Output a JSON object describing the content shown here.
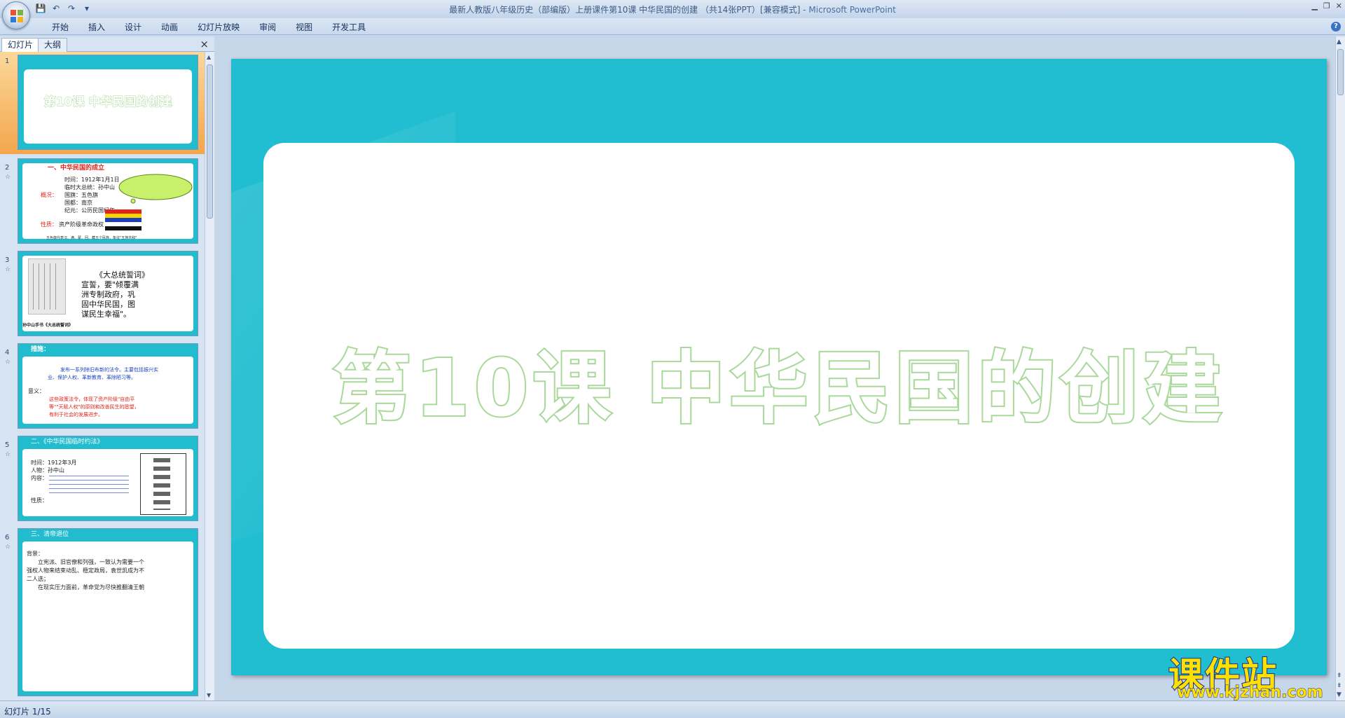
{
  "titlebar": {
    "title": "最新人教版八年级历史（部编版）上册课件第10课  中华民国的创建 （共14张PPT）[兼容模式]",
    "app_name": "- Microsoft PowerPoint",
    "save_icon": "save-icon",
    "undo_icon": "undo-icon",
    "redo_icon": "redo-icon"
  },
  "ribbon": {
    "tabs": [
      "开始",
      "插入",
      "设计",
      "动画",
      "幻灯片放映",
      "审阅",
      "视图",
      "开发工具"
    ]
  },
  "pane": {
    "tab_slides": "幻灯片",
    "tab_outline": "大纲",
    "close": "×"
  },
  "thumbnails": [
    {
      "num": "1",
      "title": "第10课  中华民国的创建"
    },
    {
      "num": "2",
      "heading": "一、中华民国的成立",
      "label1": "概况：",
      "l1": "时间：1912年1月1日",
      "l2": "临时大总统：孙中山",
      "l3": "国旗：五色旗",
      "l4": "国都：南京",
      "l5": "纪元：公历民国纪年",
      "label2": "性质：",
      "nature": "资产阶级革命政权",
      "footer": "五色旗代表汉、满、蒙、回、藏五个民族，象征\"五族共和\""
    },
    {
      "num": "3",
      "text1": "《大总统誓词》",
      "text2": "宣誓，要\"倾覆满",
      "text3": "洲专制政府，巩",
      "text4": "固中华民国，图",
      "text5": "谋民生幸福\"。",
      "caption": "孙中山手书《大总统誓词》"
    },
    {
      "num": "4",
      "heading": "措施：",
      "body1": "发布一系列除旧布新的法令。主要包括振兴实",
      "body2": "业、保护人权、革新教育、革除陋习等。",
      "label": "意义：",
      "body3": "这些政策法令，体现了资产阶级\"自由平",
      "body4": "等\"\"天赋人权\"的原则和改善民生的愿望，",
      "body5": "有利于社会的发展进步。"
    },
    {
      "num": "5",
      "heading": "二、《中华民国临时约法》",
      "l1": "时间：1912年3月",
      "l2": "人物：孙中山",
      "l3": "内容：",
      "l4": "性质："
    },
    {
      "num": "6",
      "heading": "三、清帝退位",
      "l1": "背景：",
      "l2": "立宪派、旧官僚和列强，一致认为需要一个",
      "l3": "强权人物来结束动乱、稳定政局，袁世凯成为不",
      "l4": "二人选；",
      "l5": "在现实压力面前，革命党为尽快推翻清王朝"
    }
  ],
  "slide": {
    "title": "第10课  中华民国的创建"
  },
  "status": {
    "text": "幻灯片 1/15"
  },
  "watermark": {
    "cn": "课件站",
    "url": "www.kjzhan.com"
  },
  "colors": {
    "slide_bg": "#21bdd0",
    "title_outline": "#a8d89a",
    "selection": "#f4a64d"
  }
}
